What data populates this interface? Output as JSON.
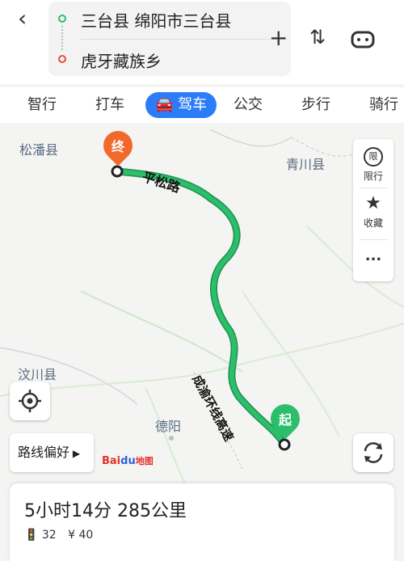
{
  "header": {
    "back_icon": "back-chevron-icon",
    "start": "三台县 绵阳市三台县",
    "end": "虎牙藏族乡",
    "add_icon": "plus-icon",
    "swap_icon": "swap-icon",
    "more_icon": "car-settings-icon"
  },
  "tabs": [
    {
      "label": "智行"
    },
    {
      "label": "打车"
    },
    {
      "label": "驾车",
      "active": true
    },
    {
      "label": "公交"
    },
    {
      "label": "步行"
    },
    {
      "label": "骑行"
    }
  ],
  "map": {
    "labels": {
      "songpan": "松潘县",
      "qingchuan": "青川县",
      "wenchuan": "汶川县",
      "deyang": "德阳"
    },
    "route_labels": {
      "pingsong": "平松路",
      "chengyu": "成渝环线高速"
    },
    "pins": {
      "end": "终",
      "start": "起"
    },
    "route_color": "#2cbf6b"
  },
  "side_panel": {
    "limit_label": "限行",
    "limit_icon_text": "限",
    "fav_label": "收藏",
    "more": "..."
  },
  "route_pref": "路线偏好",
  "logo": {
    "bai": "Bai",
    "du": "du",
    "map": "地图"
  },
  "summary": {
    "duration_distance": "5小时14分  285公里",
    "lights": "32",
    "fee": "¥ 40"
  },
  "colors": {
    "accent": "#2b7cf6",
    "route": "#2cbf6b",
    "end_pin": "#f26a2b",
    "start_pin": "#2cbf6b"
  }
}
